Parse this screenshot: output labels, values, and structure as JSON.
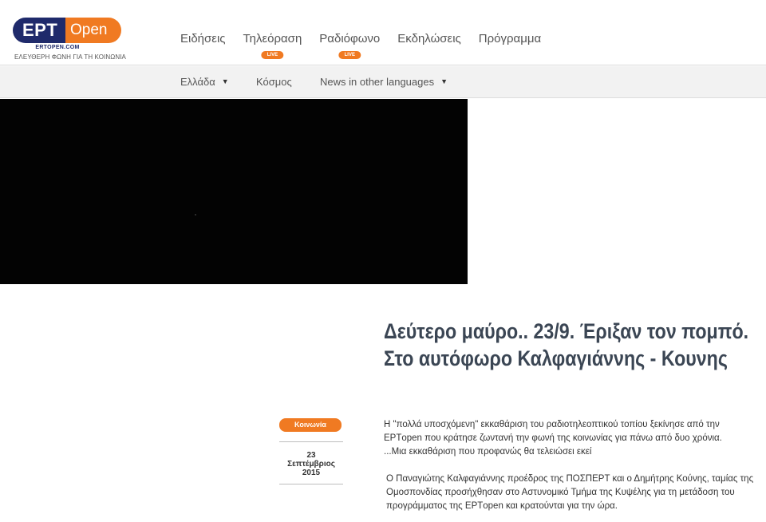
{
  "logo": {
    "ert": "EPT",
    "open": "Open",
    "domain": "ERTOPEN.COM",
    "slogan": "ΕΛΕΥΘΕΡΗ ΦΩΝΗ ΓΙΑ ΤΗ ΚΟΙΝΩΝΙΑ"
  },
  "mainnav": {
    "items": [
      {
        "label": "Ειδήσεις"
      },
      {
        "label": "Τηλεόραση",
        "badge": "LIVE"
      },
      {
        "label": "Ραδιόφωνο",
        "badge": "LIVE"
      },
      {
        "label": "Εκδηλώσεις"
      },
      {
        "label": "Πρόγραμμα"
      }
    ]
  },
  "subnav": {
    "items": [
      {
        "label": "Ελλάδα"
      },
      {
        "label": "Κόσμος"
      },
      {
        "label": "News in other languages"
      }
    ]
  },
  "article": {
    "title": "Δεύτερο μαύρο.. 23/9. Έριξαν τον πομπό. Στο αυτόφωρο Καλφαγιάννης - Κουνης",
    "category": "Κοινωνία",
    "date": {
      "day": "23",
      "month": "Σεπτέμβριος",
      "year": "2015"
    },
    "paragraphs": [
      "Η \"πολλά υποσχόμενη\" εκκαθάριση του ραδιοτηλεοπτικού τοπίου ξεκίνησε από την ΕΡΤopen που κράτησε ζωντανή την φωνή της κοινωνίας για πάνω από δυο χρόνια.",
      "...Μια  εκκαθάριση που προφανώς θα τελειώσει εκεί",
      "Ο Παναγιώτης Καλφαγιάννης προέδρος της ΠΟΣΠΕΡΤ και ο Δημήτρης Κούνης, ταμίας της Ομοσπονδίας προσήχθησαν στο Αστυνομικό Τμήμα της Κυψέλης για τη μετάδοση του προγράμματος της ΕΡΤopen και κρατούνται για την ώρα."
    ]
  }
}
